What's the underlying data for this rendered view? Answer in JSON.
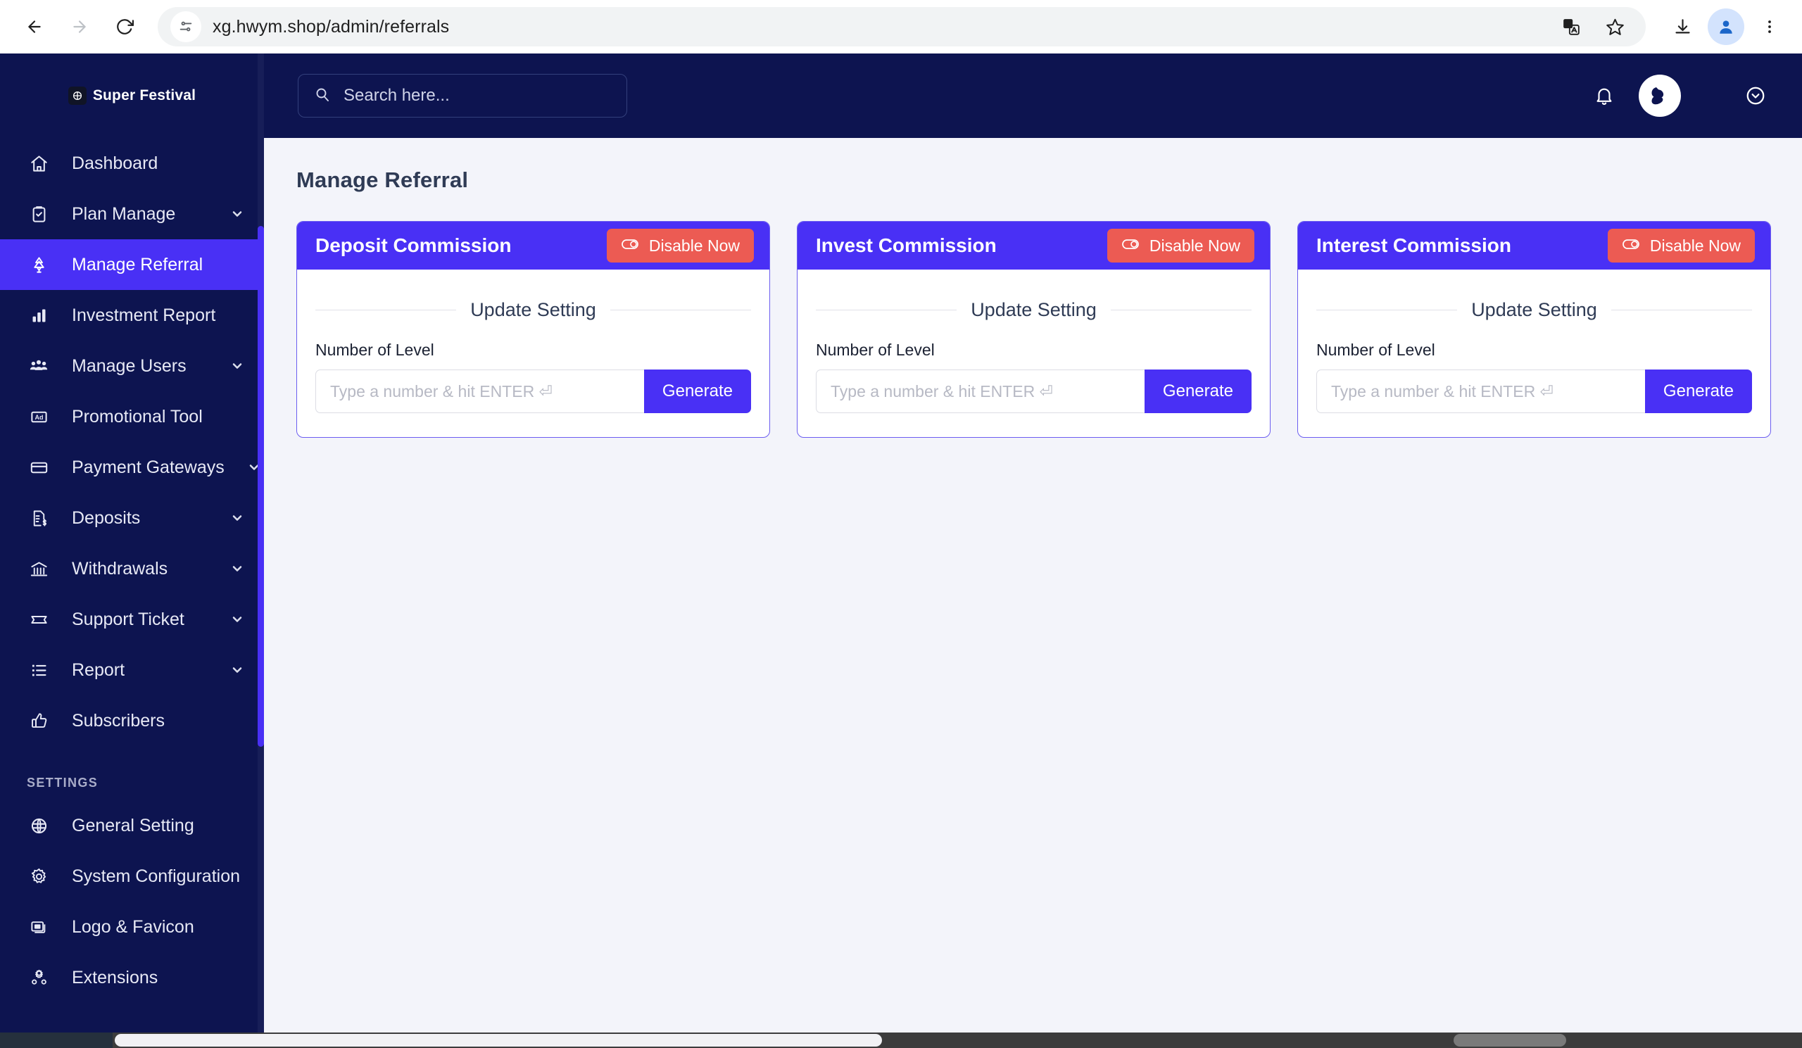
{
  "browser": {
    "url": "xg.hwym.shop/admin/referrals",
    "back_label": "Back",
    "forward_label": "Forward",
    "reload_label": "Reload",
    "site_info_label": "site-settings-icon",
    "translate_label": "Translate this page",
    "bookmark_label": "Bookmark this tab",
    "download_label": "Downloads",
    "profile_label": "Profile",
    "menu_label": "Customize and control Chrome"
  },
  "sidebar": {
    "brand": "Super Festival",
    "section_label": "SETTINGS",
    "items": [
      {
        "label": "Dashboard",
        "icon": "home-icon",
        "caret": false,
        "active": false
      },
      {
        "label": "Plan Manage",
        "icon": "clipboard-check-icon",
        "caret": true,
        "active": false
      },
      {
        "label": "Manage Referral",
        "icon": "tree-icon",
        "caret": false,
        "active": true
      },
      {
        "label": "Investment Report",
        "icon": "bar-chart-icon",
        "caret": false,
        "active": false
      },
      {
        "label": "Manage Users",
        "icon": "users-icon",
        "caret": true,
        "active": false
      },
      {
        "label": "Promotional Tool",
        "icon": "ad-icon",
        "caret": false,
        "active": false
      },
      {
        "label": "Payment Gateways",
        "icon": "credit-card-icon",
        "caret": true,
        "active": false
      },
      {
        "label": "Deposits",
        "icon": "document-dollar-icon",
        "caret": true,
        "active": false
      },
      {
        "label": "Withdrawals",
        "icon": "bank-icon",
        "caret": true,
        "active": false
      },
      {
        "label": "Support Ticket",
        "icon": "ticket-icon",
        "caret": true,
        "active": false
      },
      {
        "label": "Report",
        "icon": "list-icon",
        "caret": true,
        "active": false
      },
      {
        "label": "Subscribers",
        "icon": "thumbs-up-icon",
        "caret": false,
        "active": false
      }
    ],
    "settings_items": [
      {
        "label": "General Setting",
        "icon": "globe-icon",
        "caret": false
      },
      {
        "label": "System Configuration",
        "icon": "gear-icon",
        "caret": false
      },
      {
        "label": "Logo & Favicon",
        "icon": "windows-icon",
        "caret": false
      },
      {
        "label": "Extensions",
        "icon": "gears-icon",
        "caret": false
      }
    ]
  },
  "topbar": {
    "search_placeholder": "Search here...",
    "notification_label": "Notifications",
    "avatar_label": "User avatar",
    "dropdown_label": "Open user menu"
  },
  "page": {
    "title": "Manage Referral"
  },
  "cards": [
    {
      "title": "Deposit Commission",
      "toggle_label": "Disable Now",
      "section_title": "Update Setting",
      "field_label": "Number of Level",
      "input_placeholder": "Type a number & hit ENTER ⏎",
      "button_label": "Generate"
    },
    {
      "title": "Invest Commission",
      "toggle_label": "Disable Now",
      "section_title": "Update Setting",
      "field_label": "Number of Level",
      "input_placeholder": "Type a number & hit ENTER ⏎",
      "button_label": "Generate"
    },
    {
      "title": "Interest Commission",
      "toggle_label": "Disable Now",
      "section_title": "Update Setting",
      "field_label": "Number of Level",
      "input_placeholder": "Type a number & hit ENTER ⏎",
      "button_label": "Generate"
    }
  ],
  "colors": {
    "sidebar_bg": "#0d1450",
    "accent": "#4930f5",
    "danger": "#ec5b53",
    "content_bg": "#f3f4fa"
  }
}
